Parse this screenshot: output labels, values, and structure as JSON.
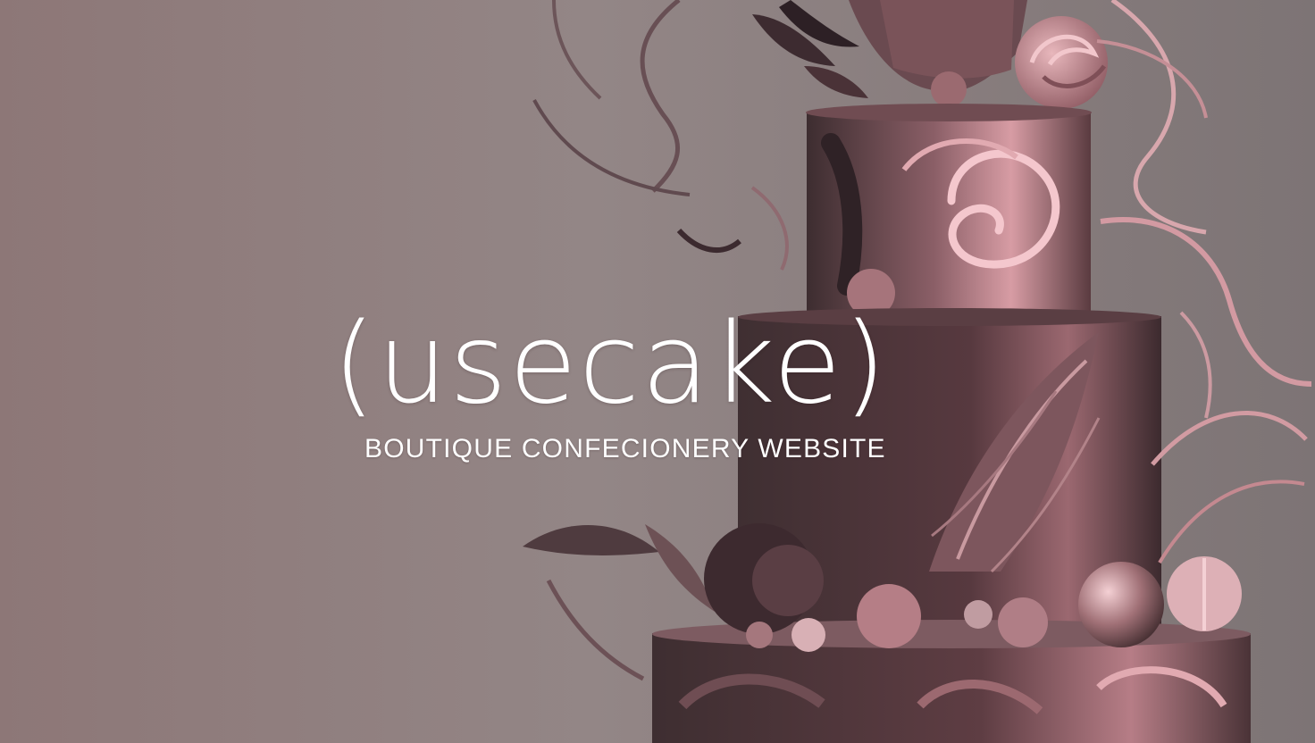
{
  "hero": {
    "brand_name": "(usecake)",
    "tagline": "BOUTIQUE CONFECIONERY  WEBSITE"
  },
  "image": {
    "subject": "three-tier chocolate cake with pink swirl decorations"
  },
  "colors": {
    "background": "#8f7e7f",
    "text": "#ffffff",
    "cake_dark": "#4a3638",
    "cake_pink": "#c99aa0",
    "ribbon_pink": "#d9aeb2"
  },
  "icons": []
}
